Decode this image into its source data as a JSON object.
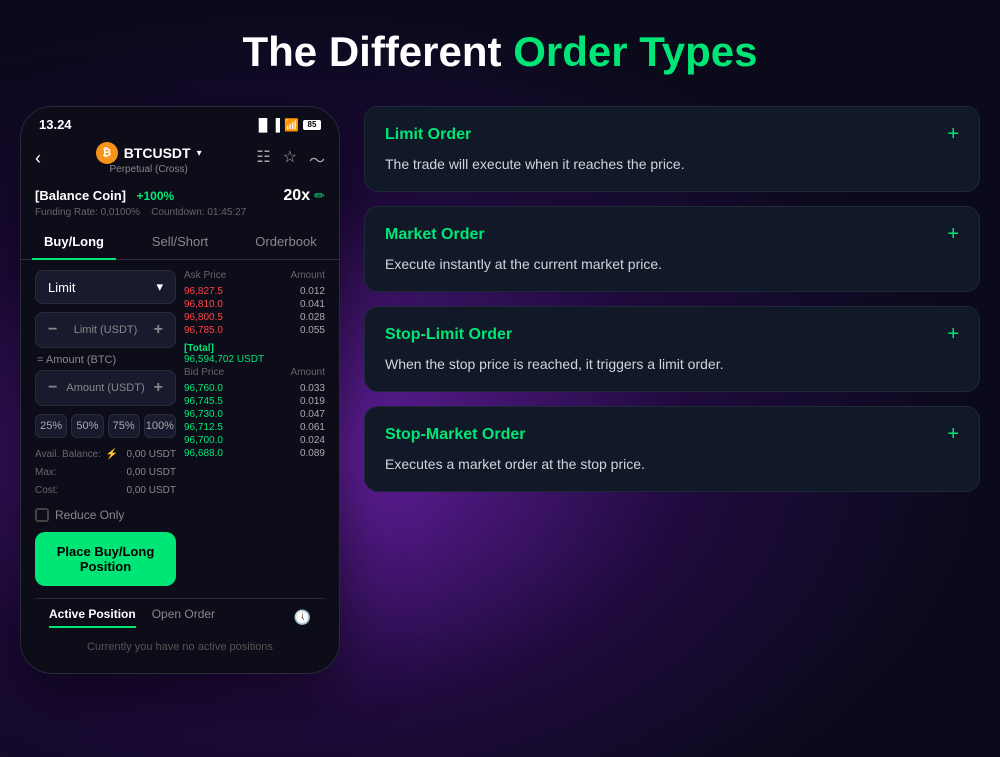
{
  "page": {
    "title_part1": "The Different",
    "title_part2": "Order Types"
  },
  "phone": {
    "status_time": "13.24",
    "battery": "85",
    "coin_name": "BTCUSDT",
    "coin_subtitle": "Perpetual (Cross)",
    "balance_label": "[Balance Coin]",
    "balance_pct": "+100%",
    "leverage": "20x",
    "funding_rate": "Funding Rate: 0,0100%",
    "countdown": "Countdown: 01:45:27",
    "tabs": [
      "Buy/Long",
      "Sell/Short",
      "Orderbook"
    ],
    "order_type": "Limit",
    "input_limit_label": "Limit (USDT)",
    "input_amount_label": "= Amount (BTC)",
    "input_amount2_label": "Amount (USDT)",
    "total_label": "[Total]",
    "total_value": "96,594,702 USDT",
    "ask_price_label": "Ask Price",
    "amount_label": "Amount",
    "bid_price_label": "Bid Price",
    "bid_amount_label": "Amount",
    "pct_buttons": [
      "25%",
      "50%",
      "75%",
      "100%"
    ],
    "avail_balance_label": "Avail. Balance:",
    "avail_balance_val": "0,00 USDT",
    "max_label": "Max:",
    "max_val": "0,00 USDT",
    "cost_label": "Cost:",
    "cost_val": "0,00 USDT",
    "reduce_only_label": "Reduce Only",
    "place_order_btn": "Place Buy/Long Position",
    "bottom_tab_active": "Active Position",
    "bottom_tab2": "Open Order",
    "no_positions_text": "Currently you have no active positions"
  },
  "order_cards": [
    {
      "id": "limit-order",
      "title": "Limit Order",
      "desc": "The trade will execute when it reaches the price.",
      "plus": "+"
    },
    {
      "id": "market-order",
      "title": "Market Order",
      "desc": "Execute instantly at the current market price.",
      "plus": "+"
    },
    {
      "id": "stop-limit-order",
      "title": "Stop-Limit Order",
      "desc": "When the stop price is reached, it triggers a limit order.",
      "plus": "+"
    },
    {
      "id": "stop-market-order",
      "title": "Stop-Market Order",
      "desc": "Executes a market order at the stop price.",
      "plus": "+"
    }
  ]
}
